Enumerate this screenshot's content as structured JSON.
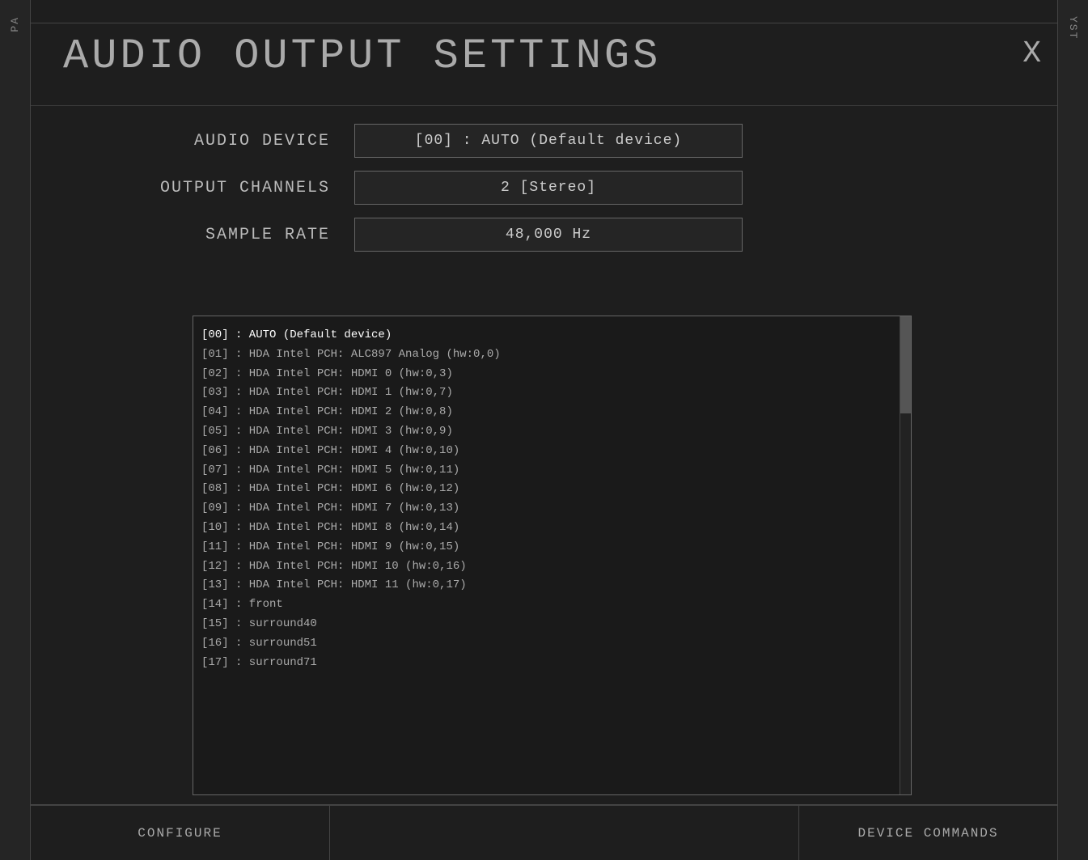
{
  "app": {
    "title": "AUDIO OUTPUT SETTINGS",
    "close_label": "X"
  },
  "left_sidebar": {
    "label": "PA"
  },
  "right_sidebar": {
    "label": "YST"
  },
  "settings": {
    "audio_device": {
      "label": "AUDIO DEVICE",
      "value": "[00] : AUTO (Default device)"
    },
    "output_channels": {
      "label": "OUTPUT CHANNELS",
      "value": "2 [Stereo]"
    },
    "sample_rate": {
      "label": "SAMPLE RATE",
      "value": "48,000 Hz"
    }
  },
  "device_list": {
    "items": [
      "[00] : AUTO (Default device)",
      "[01] : HDA Intel PCH: ALC897 Analog (hw:0,0)",
      "[02] : HDA Intel PCH: HDMI 0 (hw:0,3)",
      "[03] : HDA Intel PCH: HDMI 1 (hw:0,7)",
      "[04] : HDA Intel PCH: HDMI 2 (hw:0,8)",
      "[05] : HDA Intel PCH: HDMI 3 (hw:0,9)",
      "[06] : HDA Intel PCH: HDMI 4 (hw:0,10)",
      "[07] : HDA Intel PCH: HDMI 5 (hw:0,11)",
      "[08] : HDA Intel PCH: HDMI 6 (hw:0,12)",
      "[09] : HDA Intel PCH: HDMI 7 (hw:0,13)",
      "[10] : HDA Intel PCH: HDMI 8 (hw:0,14)",
      "[11] : HDA Intel PCH: HDMI 9 (hw:0,15)",
      "[12] : HDA Intel PCH: HDMI 10 (hw:0,16)",
      "[13] : HDA Intel PCH: HDMI 11 (hw:0,17)",
      "[14] : front",
      "[15] : surround40",
      "[16] : surround51",
      "[17] : surround71"
    ]
  },
  "footer": {
    "configure_label": "CONFIGURE",
    "device_commands_label": "DEVICE COMMANDS"
  }
}
